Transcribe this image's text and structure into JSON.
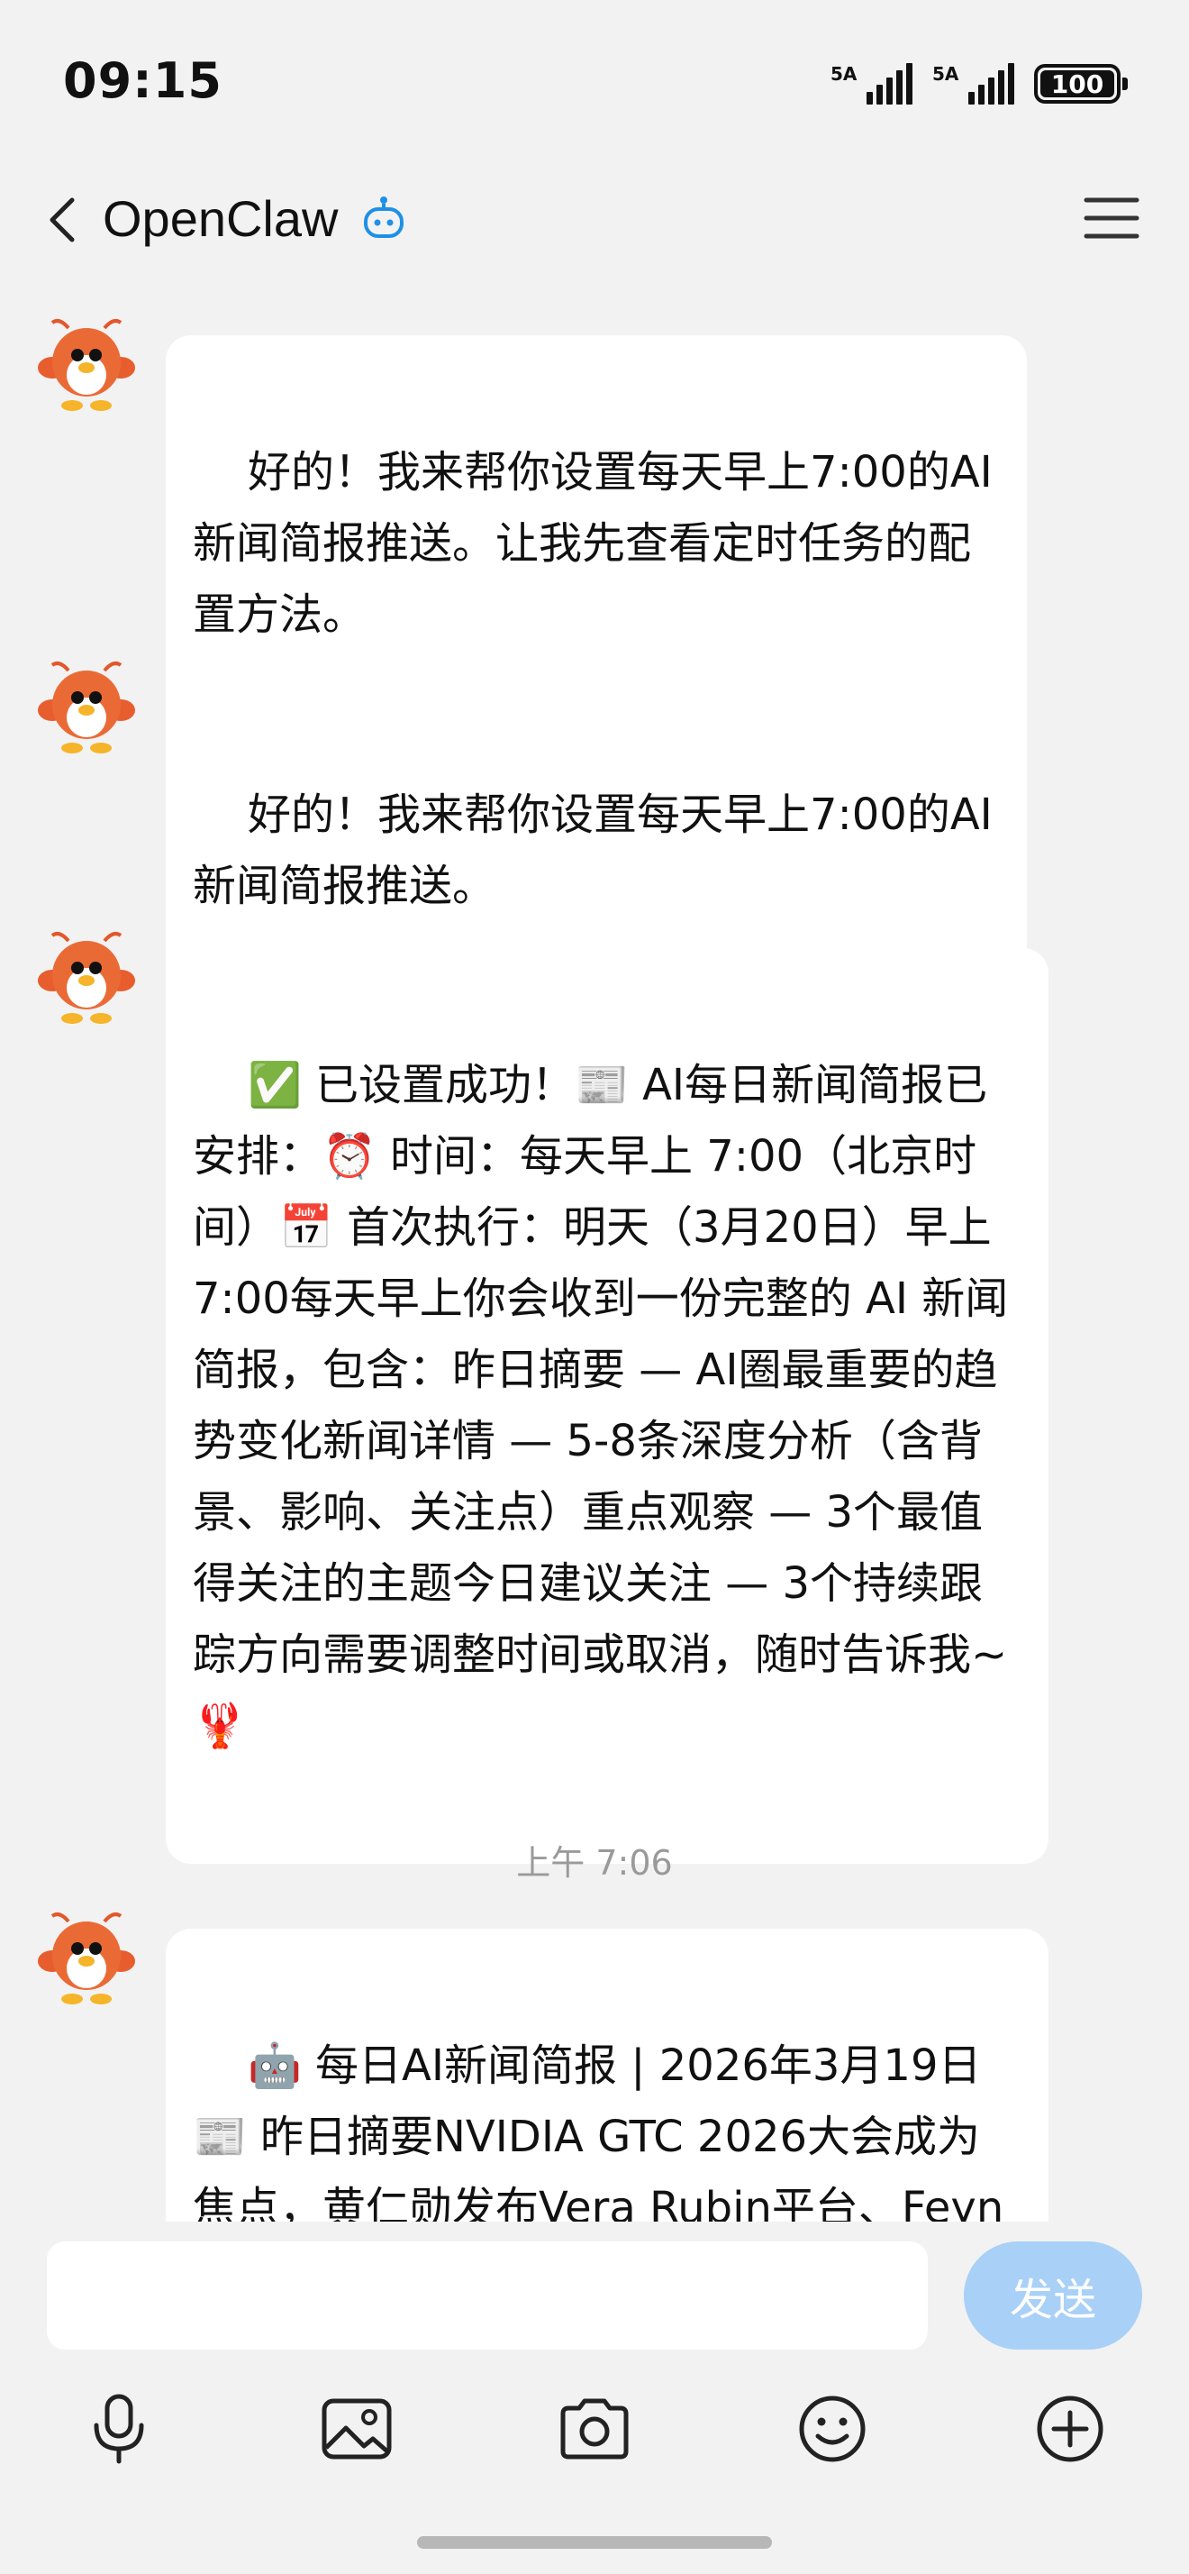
{
  "status_bar": {
    "time": "09:15",
    "signal1_label": "5A",
    "signal2_label": "5A",
    "battery": "100"
  },
  "header": {
    "title": "OpenClaw",
    "back_icon": "chevron-left-icon",
    "bot_icon": "robot-icon",
    "menu_icon": "hamburger-menu-icon"
  },
  "messages": [
    {
      "sender": "bot",
      "text": "好的！我来帮你设置每天早上7:00的AI新闻简报推送。让我先查看定时任务的配置方法。"
    },
    {
      "sender": "bot",
      "text": "好的！我来帮你设置每天早上7:00的AI新闻简报推送。"
    },
    {
      "sender": "bot",
      "text": "✅ 已设置成功！📰 AI每日新闻简报已安排：⏰ 时间：每天早上 7:00（北京时间）📅 首次执行：明天（3月20日）早上 7:00每天早上你会收到一份完整的 AI 新闻简报，包含：昨日摘要 — AI圈最重要的趋势变化新闻详情 — 5-8条深度分析（含背景、影响、关注点）重点观察 — 3个最值得关注的主题今日建议关注 — 3个持续跟踪方向需要调整时间或取消，随时告诉我~ 🦞"
    },
    {
      "sender": "bot",
      "text": "🤖 每日AI新闻简报 | 2026年3月19日📰 昨日摘要NVIDIA GTC 2026大会成为焦点，黄仁勋发布Vera Rubin平台、Feynman架构及太空AI数据中心"
    }
  ],
  "timestamp": "上午 7:06",
  "input": {
    "placeholder": "",
    "value": "",
    "send_label": "发送"
  },
  "toolbar": {
    "items": [
      "microphone-icon",
      "image-icon",
      "camera-icon",
      "emoji-icon",
      "plus-circle-icon"
    ]
  },
  "colors": {
    "background": "#f2f2f2",
    "bubble": "#ffffff",
    "send_button": "#a9d0f7",
    "accent": "#1e90e6"
  }
}
